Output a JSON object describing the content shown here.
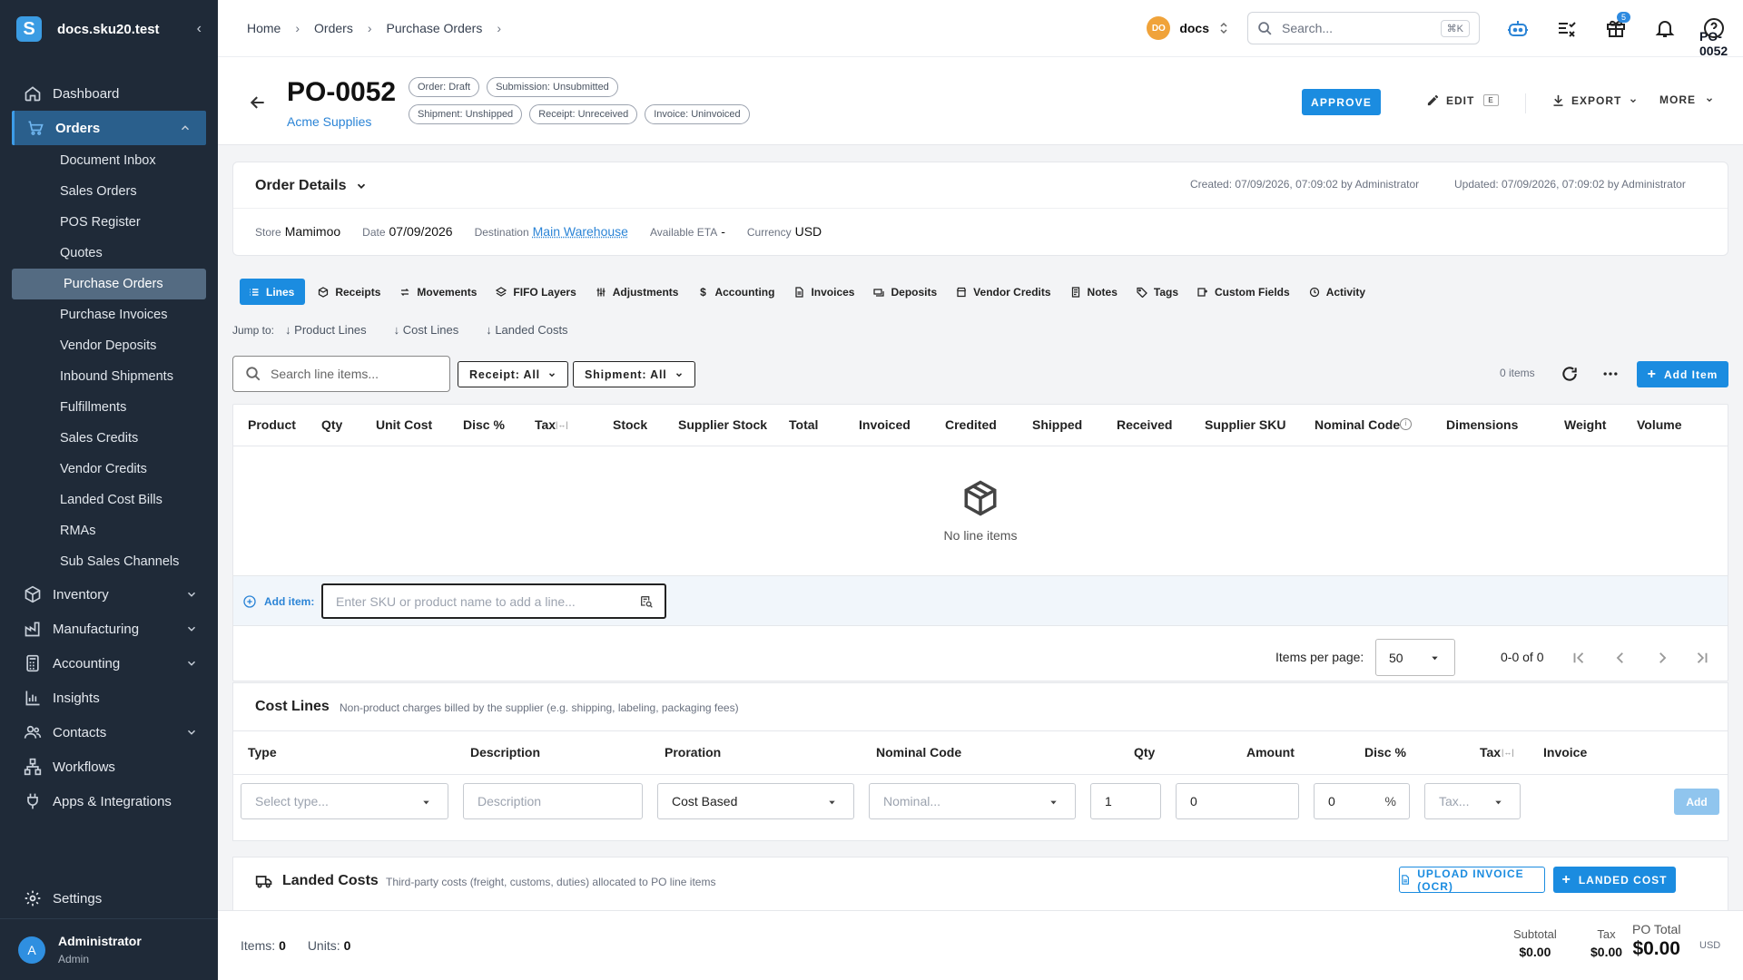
{
  "sidebar": {
    "brand": "docs.sku20.test",
    "logo_letter": "S",
    "items": [
      {
        "label": "Dashboard",
        "icon": "home-icon"
      },
      {
        "label": "Orders",
        "icon": "cart-icon"
      },
      {
        "label": "Inventory",
        "icon": "box-icon"
      },
      {
        "label": "Manufacturing",
        "icon": "factory-icon"
      },
      {
        "label": "Accounting",
        "icon": "calculator-icon"
      },
      {
        "label": "Insights",
        "icon": "chart-icon"
      },
      {
        "label": "Contacts",
        "icon": "contacts-icon"
      },
      {
        "label": "Workflows",
        "icon": "workflow-icon"
      },
      {
        "label": "Apps & Integrations",
        "icon": "plug-icon"
      }
    ],
    "orders_sub": [
      "Document Inbox",
      "Sales Orders",
      "POS Register",
      "Quotes",
      "Purchase Orders",
      "Purchase Invoices",
      "Vendor Deposits",
      "Inbound Shipments",
      "Fulfillments",
      "Sales Credits",
      "Vendor Credits",
      "Landed Cost Bills",
      "RMAs",
      "Sub Sales Channels"
    ],
    "settings": "Settings",
    "user": {
      "initial": "A",
      "name": "Administrator",
      "role": "Admin"
    }
  },
  "topbar": {
    "breadcrumbs": [
      "Home",
      "Orders",
      "Purchase Orders",
      "PO-0052"
    ],
    "workspace_initials": "DO",
    "workspace": "docs",
    "search_placeholder": "Search...",
    "search_shortcut": "⌘K",
    "gift_badge": "5"
  },
  "header": {
    "title": "PO-0052",
    "supplier": "Acme Supplies",
    "chips_row1": [
      "Order: Draft",
      "Submission: Unsubmitted"
    ],
    "chips_row2": [
      "Shipment: Unshipped",
      "Receipt: Unreceived",
      "Invoice: Uninvoiced"
    ],
    "approve": "APPROVE",
    "edit": "EDIT",
    "edit_key": "E",
    "export": "EXPORT",
    "more": "MORE"
  },
  "order_details": {
    "title": "Order Details",
    "created": "Created: 07/09/2026, 07:09:02 by Administrator",
    "updated": "Updated: 07/09/2026, 07:09:02 by Administrator",
    "store_label": "Store",
    "store": "Mamimoo",
    "date_label": "Date",
    "date": "07/09/2026",
    "destination_label": "Destination",
    "destination": "Main Warehouse",
    "eta_label": "Available ETA",
    "eta": "-",
    "currency_label": "Currency",
    "currency": "USD"
  },
  "tabs": [
    "Lines",
    "Receipts",
    "Movements",
    "FIFO Layers",
    "Adjustments",
    "Accounting",
    "Invoices",
    "Deposits",
    "Vendor Credits",
    "Notes",
    "Tags",
    "Custom Fields",
    "Activity"
  ],
  "jump": {
    "label": "Jump to:",
    "links": [
      "Product Lines",
      "Cost Lines",
      "Landed Costs"
    ]
  },
  "lines_toolbar": {
    "search_placeholder": "Search line items...",
    "receipt_filter": "Receipt: All",
    "shipment_filter": "Shipment: All",
    "count": "0 items",
    "add_item": "Add Item"
  },
  "lines_table": {
    "columns": [
      "Product",
      "Qty",
      "Unit Cost",
      "Disc %",
      "Tax",
      "Stock",
      "Supplier Stock",
      "Total",
      "Invoiced",
      "Credited",
      "Shipped",
      "Received",
      "Supplier SKU",
      "Nominal Code",
      "Dimensions",
      "Weight",
      "Volume"
    ],
    "empty": "No line items",
    "add_label": "Add item:",
    "add_placeholder": "Enter SKU or product name to add a line..."
  },
  "pager": {
    "per_page_label": "Items per page:",
    "per_page": "50",
    "range": "0-0 of 0"
  },
  "cost_lines": {
    "title": "Cost Lines",
    "subtitle": "Non-product charges billed by the supplier (e.g. shipping, labeling, packaging fees)",
    "columns": [
      "Type",
      "Description",
      "Proration",
      "Nominal Code",
      "Qty",
      "Amount",
      "Disc %",
      "Tax",
      "Invoice"
    ],
    "type_placeholder": "Select type...",
    "desc_placeholder": "Description",
    "proration": "Cost Based",
    "nominal_placeholder": "Nominal...",
    "qty": "1",
    "amount": "0",
    "disc": "0",
    "disc_unit": "%",
    "tax_placeholder": "Tax...",
    "add": "Add"
  },
  "landed_costs": {
    "title": "Landed Costs",
    "subtitle": "Third-party costs (freight, customs, duties) allocated to PO line items",
    "upload": "UPLOAD INVOICE (OCR)",
    "add": "LANDED COST"
  },
  "footer": {
    "items_label": "Items:",
    "items": "0",
    "units_label": "Units:",
    "units": "0",
    "subtotal_label": "Subtotal",
    "subtotal": "$0.00",
    "tax_label": "Tax",
    "tax": "$0.00",
    "total_label": "PO Total",
    "total": "$0.00",
    "currency": "USD"
  },
  "colors": {
    "primary": "#1b8ce0",
    "sidebar": "#1f2a38",
    "active_item": "#2a5f8c"
  }
}
